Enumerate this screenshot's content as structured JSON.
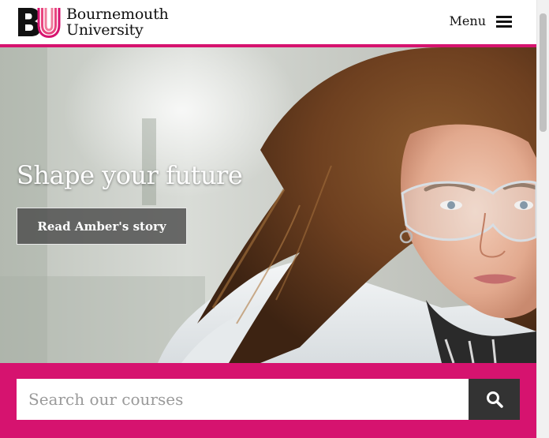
{
  "header": {
    "logo_line1": "Bournemouth",
    "logo_line2": "University",
    "logo_mark_letters": "BU",
    "menu_label": "Menu"
  },
  "hero": {
    "title": "Shape your future",
    "button_label": "Read Amber's story"
  },
  "search": {
    "placeholder": "Search our courses",
    "value": ""
  },
  "colors": {
    "brand_magenta": "#d6136f",
    "search_button": "#333333",
    "hero_button_bg": "#464646"
  },
  "icons": {
    "menu": "hamburger-icon",
    "search": "search-icon"
  }
}
